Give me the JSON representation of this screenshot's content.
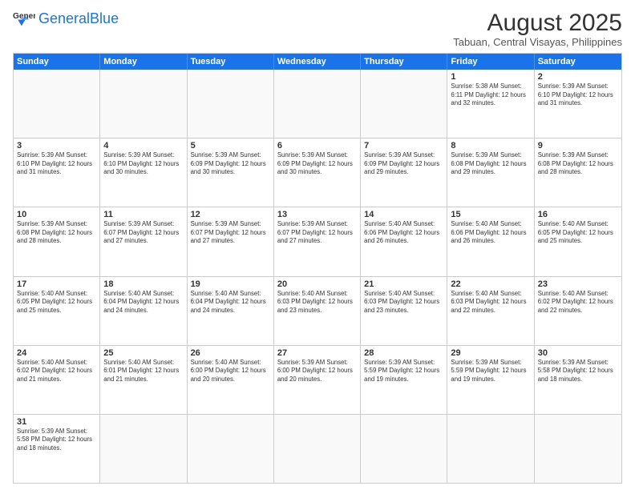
{
  "header": {
    "logo_general": "General",
    "logo_blue": "Blue",
    "month_year": "August 2025",
    "location": "Tabuan, Central Visayas, Philippines"
  },
  "calendar": {
    "days_of_week": [
      "Sunday",
      "Monday",
      "Tuesday",
      "Wednesday",
      "Thursday",
      "Friday",
      "Saturday"
    ],
    "weeks": [
      [
        {
          "day": "",
          "empty": true
        },
        {
          "day": "",
          "empty": true
        },
        {
          "day": "",
          "empty": true
        },
        {
          "day": "",
          "empty": true
        },
        {
          "day": "",
          "empty": true
        },
        {
          "day": "1",
          "info": "Sunrise: 5:38 AM\nSunset: 6:11 PM\nDaylight: 12 hours and 32 minutes."
        },
        {
          "day": "2",
          "info": "Sunrise: 5:39 AM\nSunset: 6:10 PM\nDaylight: 12 hours and 31 minutes."
        }
      ],
      [
        {
          "day": "3",
          "info": "Sunrise: 5:39 AM\nSunset: 6:10 PM\nDaylight: 12 hours and 31 minutes."
        },
        {
          "day": "4",
          "info": "Sunrise: 5:39 AM\nSunset: 6:10 PM\nDaylight: 12 hours and 30 minutes."
        },
        {
          "day": "5",
          "info": "Sunrise: 5:39 AM\nSunset: 6:09 PM\nDaylight: 12 hours and 30 minutes."
        },
        {
          "day": "6",
          "info": "Sunrise: 5:39 AM\nSunset: 6:09 PM\nDaylight: 12 hours and 30 minutes."
        },
        {
          "day": "7",
          "info": "Sunrise: 5:39 AM\nSunset: 6:09 PM\nDaylight: 12 hours and 29 minutes."
        },
        {
          "day": "8",
          "info": "Sunrise: 5:39 AM\nSunset: 6:08 PM\nDaylight: 12 hours and 29 minutes."
        },
        {
          "day": "9",
          "info": "Sunrise: 5:39 AM\nSunset: 6:08 PM\nDaylight: 12 hours and 28 minutes."
        }
      ],
      [
        {
          "day": "10",
          "info": "Sunrise: 5:39 AM\nSunset: 6:08 PM\nDaylight: 12 hours and 28 minutes."
        },
        {
          "day": "11",
          "info": "Sunrise: 5:39 AM\nSunset: 6:07 PM\nDaylight: 12 hours and 27 minutes."
        },
        {
          "day": "12",
          "info": "Sunrise: 5:39 AM\nSunset: 6:07 PM\nDaylight: 12 hours and 27 minutes."
        },
        {
          "day": "13",
          "info": "Sunrise: 5:39 AM\nSunset: 6:07 PM\nDaylight: 12 hours and 27 minutes."
        },
        {
          "day": "14",
          "info": "Sunrise: 5:40 AM\nSunset: 6:06 PM\nDaylight: 12 hours and 26 minutes."
        },
        {
          "day": "15",
          "info": "Sunrise: 5:40 AM\nSunset: 6:06 PM\nDaylight: 12 hours and 26 minutes."
        },
        {
          "day": "16",
          "info": "Sunrise: 5:40 AM\nSunset: 6:05 PM\nDaylight: 12 hours and 25 minutes."
        }
      ],
      [
        {
          "day": "17",
          "info": "Sunrise: 5:40 AM\nSunset: 6:05 PM\nDaylight: 12 hours and 25 minutes."
        },
        {
          "day": "18",
          "info": "Sunrise: 5:40 AM\nSunset: 6:04 PM\nDaylight: 12 hours and 24 minutes."
        },
        {
          "day": "19",
          "info": "Sunrise: 5:40 AM\nSunset: 6:04 PM\nDaylight: 12 hours and 24 minutes."
        },
        {
          "day": "20",
          "info": "Sunrise: 5:40 AM\nSunset: 6:03 PM\nDaylight: 12 hours and 23 minutes."
        },
        {
          "day": "21",
          "info": "Sunrise: 5:40 AM\nSunset: 6:03 PM\nDaylight: 12 hours and 23 minutes."
        },
        {
          "day": "22",
          "info": "Sunrise: 5:40 AM\nSunset: 6:03 PM\nDaylight: 12 hours and 22 minutes."
        },
        {
          "day": "23",
          "info": "Sunrise: 5:40 AM\nSunset: 6:02 PM\nDaylight: 12 hours and 22 minutes."
        }
      ],
      [
        {
          "day": "24",
          "info": "Sunrise: 5:40 AM\nSunset: 6:02 PM\nDaylight: 12 hours and 21 minutes."
        },
        {
          "day": "25",
          "info": "Sunrise: 5:40 AM\nSunset: 6:01 PM\nDaylight: 12 hours and 21 minutes."
        },
        {
          "day": "26",
          "info": "Sunrise: 5:40 AM\nSunset: 6:00 PM\nDaylight: 12 hours and 20 minutes."
        },
        {
          "day": "27",
          "info": "Sunrise: 5:39 AM\nSunset: 6:00 PM\nDaylight: 12 hours and 20 minutes."
        },
        {
          "day": "28",
          "info": "Sunrise: 5:39 AM\nSunset: 5:59 PM\nDaylight: 12 hours and 19 minutes."
        },
        {
          "day": "29",
          "info": "Sunrise: 5:39 AM\nSunset: 5:59 PM\nDaylight: 12 hours and 19 minutes."
        },
        {
          "day": "30",
          "info": "Sunrise: 5:39 AM\nSunset: 5:58 PM\nDaylight: 12 hours and 18 minutes."
        }
      ],
      [
        {
          "day": "31",
          "info": "Sunrise: 5:39 AM\nSunset: 5:58 PM\nDaylight: 12 hours and 18 minutes."
        },
        {
          "day": "",
          "empty": true
        },
        {
          "day": "",
          "empty": true
        },
        {
          "day": "",
          "empty": true
        },
        {
          "day": "",
          "empty": true
        },
        {
          "day": "",
          "empty": true
        },
        {
          "day": "",
          "empty": true
        }
      ]
    ]
  }
}
